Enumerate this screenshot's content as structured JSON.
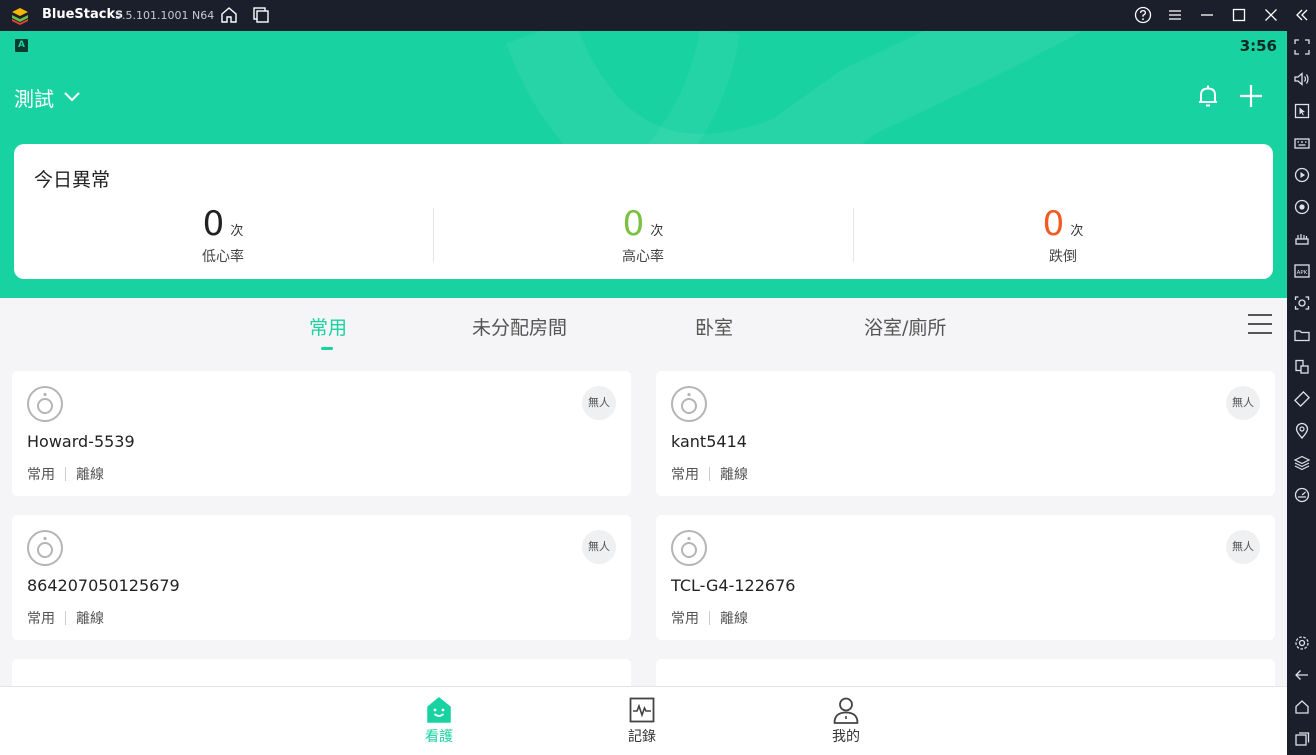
{
  "window": {
    "app_name": "BlueStacks",
    "version": "5.5.101.1001 N64"
  },
  "status_bar": {
    "indicator": "A",
    "time": "3:56"
  },
  "header": {
    "title": "測試"
  },
  "summary": {
    "title": "今日異常",
    "stats": [
      {
        "value": "0",
        "unit": "次",
        "label": "低心率",
        "color": "#222222"
      },
      {
        "value": "0",
        "unit": "次",
        "label": "高心率",
        "color": "#7ac142"
      },
      {
        "value": "0",
        "unit": "次",
        "label": "跌倒",
        "color": "#f15a22"
      }
    ]
  },
  "tabs": [
    {
      "label": "常用",
      "active": true
    },
    {
      "label": "未分配房間",
      "active": false
    },
    {
      "label": "卧室",
      "active": false
    },
    {
      "label": "浴室/廁所",
      "active": false
    }
  ],
  "devices": [
    {
      "name": "Howard-5539",
      "badge": "無人",
      "room": "常用",
      "status": "離線"
    },
    {
      "name": "kant5414",
      "badge": "無人",
      "room": "常用",
      "status": "離線"
    },
    {
      "name": "864207050125679",
      "badge": "無人",
      "room": "常用",
      "status": "離線"
    },
    {
      "name": "TCL-G4-122676",
      "badge": "無人",
      "room": "常用",
      "status": "離線"
    }
  ],
  "bottom_nav": [
    {
      "label": "看護",
      "icon": "home-face-icon",
      "active": true
    },
    {
      "label": "記錄",
      "icon": "chart-record-icon",
      "active": false
    },
    {
      "label": "我的",
      "icon": "person-icon",
      "active": false
    }
  ],
  "colors": {
    "accent": "#19d2a2",
    "titlebar": "#1b1e2b",
    "green_value": "#7ac142",
    "orange_value": "#f15a22"
  }
}
